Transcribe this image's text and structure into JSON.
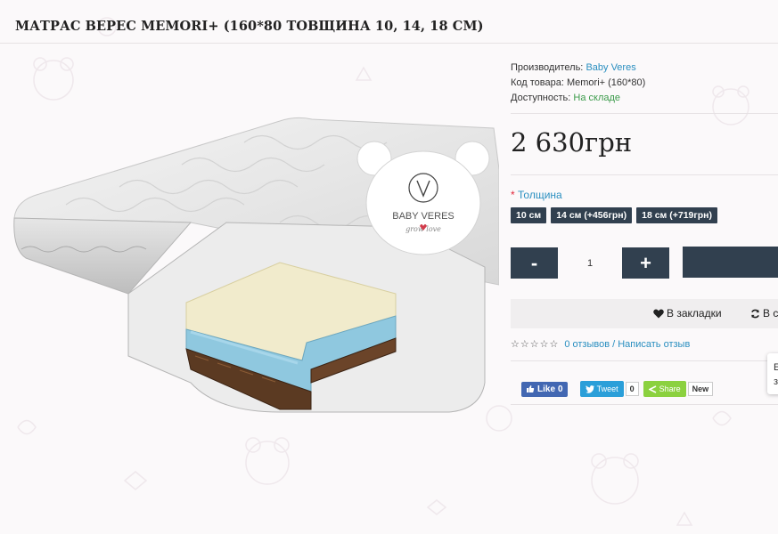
{
  "product": {
    "title": "МАТРАС ВЕРЕС MEMORI+ (160*80 ТОВЩИНА 10, 14, 18 СМ)",
    "manufacturer_label": "Производитель:",
    "manufacturer_value": "Baby Veres",
    "code_label": "Код товара:",
    "code_value": "Memori+ (160*80)",
    "availability_label": "Доступность:",
    "availability_value": "На складе",
    "price": "2 630грн"
  },
  "image": {
    "logo_brand": "BABY VERES",
    "logo_tagline": "grow love"
  },
  "options": {
    "required_mark": "*",
    "label": "Толщина",
    "items": [
      "10 см",
      "14 см (+456грн)",
      "18 см (+719грн)"
    ]
  },
  "quantity": {
    "minus": "-",
    "value": "1",
    "plus": "+"
  },
  "actions": {
    "wishlist": "В закладки",
    "compare": "В с"
  },
  "rating": {
    "stars": "☆☆☆☆☆",
    "reviews": "0 отзывов",
    "separator": "/",
    "write": "Написать отзыв"
  },
  "social": {
    "fb_like": "Like",
    "fb_count": "0",
    "tweet": "Tweet",
    "tweet_count": "0",
    "share": "Share",
    "share_count": "New"
  },
  "popup": {
    "line1": "Е",
    "line2": "з"
  },
  "colors": {
    "dark_button": "#31404f",
    "link": "#2a8fc0",
    "in_stock": "#3c9b4b",
    "required": "#e2263a",
    "facebook": "#4267b2",
    "twitter": "#2b9fd9",
    "share": "#8bd13f"
  }
}
